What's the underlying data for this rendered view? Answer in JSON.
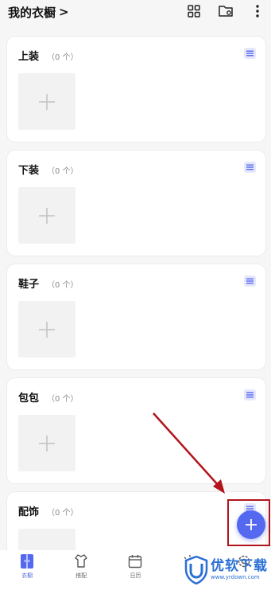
{
  "header": {
    "title": "我的衣橱",
    "chevron": ">"
  },
  "toolbar": {
    "icons": [
      "grid-icon",
      "folder-settings-icon",
      "more-vert-icon"
    ]
  },
  "categories": [
    {
      "title": "上装",
      "count": "（0 个）"
    },
    {
      "title": "下装",
      "count": "（0 个）"
    },
    {
      "title": "鞋子",
      "count": "（0 个）"
    },
    {
      "title": "包包",
      "count": "（0 个）"
    },
    {
      "title": "配饰",
      "count": "（0 个）"
    }
  ],
  "bottom_nav": {
    "items": [
      {
        "label": "衣橱",
        "icon": "wardrobe-icon",
        "active": true
      },
      {
        "label": "搭配",
        "icon": "outfit-icon",
        "active": false
      },
      {
        "label": "日历",
        "icon": "calendar-icon",
        "active": false
      },
      {
        "label": "",
        "icon": "sun-icon",
        "active": false
      },
      {
        "label": "",
        "icon": "settings-icon",
        "active": false
      }
    ]
  },
  "fab": {
    "icon": "plus-icon"
  },
  "watermark": {
    "title": "优软下载",
    "url": "www.yrdown.com"
  },
  "colors": {
    "accent": "#5468f0",
    "menu_badge_bg": "#e6e7fb",
    "annotation_red": "#b3141c",
    "watermark_blue": "#2a6fd6"
  }
}
